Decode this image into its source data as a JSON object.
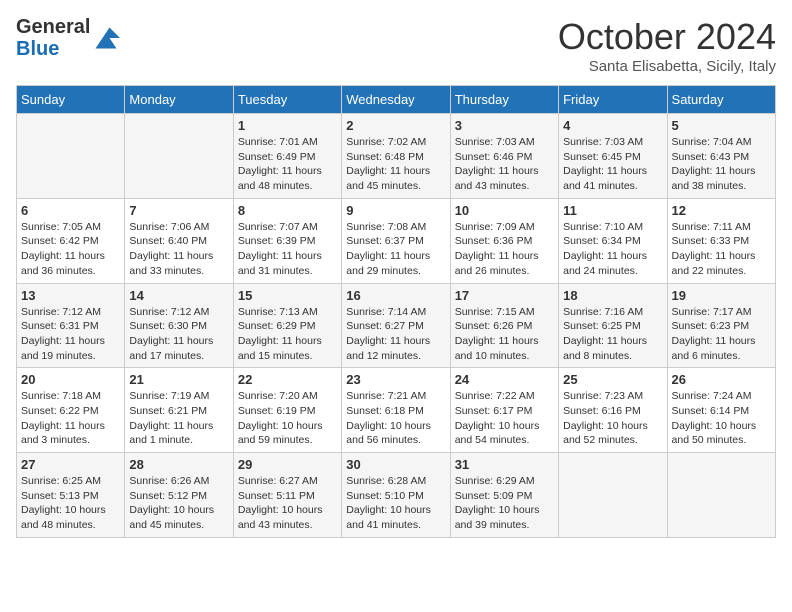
{
  "header": {
    "logo_line1": "General",
    "logo_line2": "Blue",
    "month": "October 2024",
    "location": "Santa Elisabetta, Sicily, Italy"
  },
  "days_of_week": [
    "Sunday",
    "Monday",
    "Tuesday",
    "Wednesday",
    "Thursday",
    "Friday",
    "Saturday"
  ],
  "weeks": [
    [
      {
        "day": "",
        "info": ""
      },
      {
        "day": "",
        "info": ""
      },
      {
        "day": "1",
        "info": "Sunrise: 7:01 AM\nSunset: 6:49 PM\nDaylight: 11 hours and 48 minutes."
      },
      {
        "day": "2",
        "info": "Sunrise: 7:02 AM\nSunset: 6:48 PM\nDaylight: 11 hours and 45 minutes."
      },
      {
        "day": "3",
        "info": "Sunrise: 7:03 AM\nSunset: 6:46 PM\nDaylight: 11 hours and 43 minutes."
      },
      {
        "day": "4",
        "info": "Sunrise: 7:03 AM\nSunset: 6:45 PM\nDaylight: 11 hours and 41 minutes."
      },
      {
        "day": "5",
        "info": "Sunrise: 7:04 AM\nSunset: 6:43 PM\nDaylight: 11 hours and 38 minutes."
      }
    ],
    [
      {
        "day": "6",
        "info": "Sunrise: 7:05 AM\nSunset: 6:42 PM\nDaylight: 11 hours and 36 minutes."
      },
      {
        "day": "7",
        "info": "Sunrise: 7:06 AM\nSunset: 6:40 PM\nDaylight: 11 hours and 33 minutes."
      },
      {
        "day": "8",
        "info": "Sunrise: 7:07 AM\nSunset: 6:39 PM\nDaylight: 11 hours and 31 minutes."
      },
      {
        "day": "9",
        "info": "Sunrise: 7:08 AM\nSunset: 6:37 PM\nDaylight: 11 hours and 29 minutes."
      },
      {
        "day": "10",
        "info": "Sunrise: 7:09 AM\nSunset: 6:36 PM\nDaylight: 11 hours and 26 minutes."
      },
      {
        "day": "11",
        "info": "Sunrise: 7:10 AM\nSunset: 6:34 PM\nDaylight: 11 hours and 24 minutes."
      },
      {
        "day": "12",
        "info": "Sunrise: 7:11 AM\nSunset: 6:33 PM\nDaylight: 11 hours and 22 minutes."
      }
    ],
    [
      {
        "day": "13",
        "info": "Sunrise: 7:12 AM\nSunset: 6:31 PM\nDaylight: 11 hours and 19 minutes."
      },
      {
        "day": "14",
        "info": "Sunrise: 7:12 AM\nSunset: 6:30 PM\nDaylight: 11 hours and 17 minutes."
      },
      {
        "day": "15",
        "info": "Sunrise: 7:13 AM\nSunset: 6:29 PM\nDaylight: 11 hours and 15 minutes."
      },
      {
        "day": "16",
        "info": "Sunrise: 7:14 AM\nSunset: 6:27 PM\nDaylight: 11 hours and 12 minutes."
      },
      {
        "day": "17",
        "info": "Sunrise: 7:15 AM\nSunset: 6:26 PM\nDaylight: 11 hours and 10 minutes."
      },
      {
        "day": "18",
        "info": "Sunrise: 7:16 AM\nSunset: 6:25 PM\nDaylight: 11 hours and 8 minutes."
      },
      {
        "day": "19",
        "info": "Sunrise: 7:17 AM\nSunset: 6:23 PM\nDaylight: 11 hours and 6 minutes."
      }
    ],
    [
      {
        "day": "20",
        "info": "Sunrise: 7:18 AM\nSunset: 6:22 PM\nDaylight: 11 hours and 3 minutes."
      },
      {
        "day": "21",
        "info": "Sunrise: 7:19 AM\nSunset: 6:21 PM\nDaylight: 11 hours and 1 minute."
      },
      {
        "day": "22",
        "info": "Sunrise: 7:20 AM\nSunset: 6:19 PM\nDaylight: 10 hours and 59 minutes."
      },
      {
        "day": "23",
        "info": "Sunrise: 7:21 AM\nSunset: 6:18 PM\nDaylight: 10 hours and 56 minutes."
      },
      {
        "day": "24",
        "info": "Sunrise: 7:22 AM\nSunset: 6:17 PM\nDaylight: 10 hours and 54 minutes."
      },
      {
        "day": "25",
        "info": "Sunrise: 7:23 AM\nSunset: 6:16 PM\nDaylight: 10 hours and 52 minutes."
      },
      {
        "day": "26",
        "info": "Sunrise: 7:24 AM\nSunset: 6:14 PM\nDaylight: 10 hours and 50 minutes."
      }
    ],
    [
      {
        "day": "27",
        "info": "Sunrise: 6:25 AM\nSunset: 5:13 PM\nDaylight: 10 hours and 48 minutes."
      },
      {
        "day": "28",
        "info": "Sunrise: 6:26 AM\nSunset: 5:12 PM\nDaylight: 10 hours and 45 minutes."
      },
      {
        "day": "29",
        "info": "Sunrise: 6:27 AM\nSunset: 5:11 PM\nDaylight: 10 hours and 43 minutes."
      },
      {
        "day": "30",
        "info": "Sunrise: 6:28 AM\nSunset: 5:10 PM\nDaylight: 10 hours and 41 minutes."
      },
      {
        "day": "31",
        "info": "Sunrise: 6:29 AM\nSunset: 5:09 PM\nDaylight: 10 hours and 39 minutes."
      },
      {
        "day": "",
        "info": ""
      },
      {
        "day": "",
        "info": ""
      }
    ]
  ]
}
